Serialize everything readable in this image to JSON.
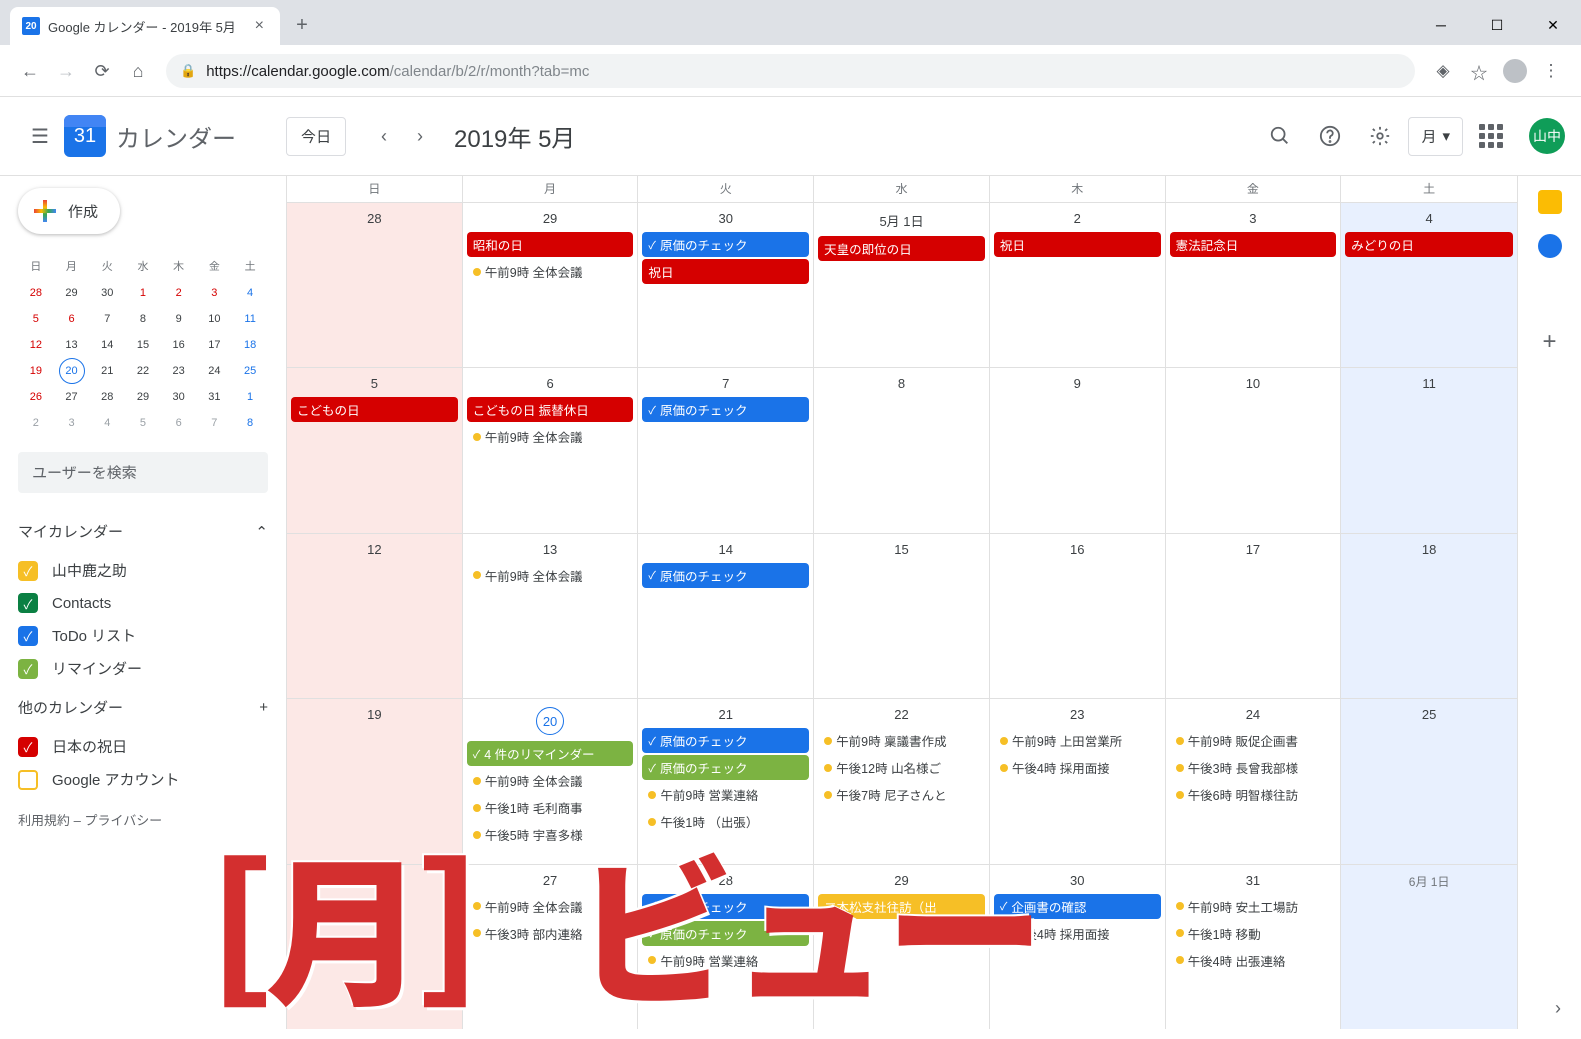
{
  "browser": {
    "tab_title": "Google カレンダー - 2019年 5月",
    "tab_favicon": "20",
    "url_host": "https://calendar.google.com",
    "url_path": "/calendar/b/2/r/month?tab=mc"
  },
  "header": {
    "app_title": "カレンダー",
    "logo_day": "31",
    "today_label": "今日",
    "month_title": "2019年 5月",
    "view_label": "月",
    "user_initials": "山中"
  },
  "sidebar": {
    "create_label": "作成",
    "search_placeholder": "ユーザーを検索",
    "my_calendars_label": "マイカレンダー",
    "other_calendars_label": "他のカレンダー",
    "calendars": [
      {
        "label": "山中鹿之助",
        "color": "#f6bf26",
        "checked": true
      },
      {
        "label": "Contacts",
        "color": "#0b8043",
        "checked": true
      },
      {
        "label": "ToDo リスト",
        "color": "#1a73e8",
        "checked": true
      },
      {
        "label": "リマインダー",
        "color": "#7cb342",
        "checked": true
      }
    ],
    "other_calendars": [
      {
        "label": "日本の祝日",
        "color": "#d50000",
        "checked": true
      },
      {
        "label": "Google アカウント",
        "color": "#f6bf26",
        "checked": false
      }
    ],
    "footer": "利用規約 – プライバシー",
    "mini_headers": [
      "日",
      "月",
      "火",
      "水",
      "木",
      "金",
      "土"
    ],
    "mini_rows": [
      [
        {
          "n": "28",
          "c": "red"
        },
        {
          "n": "29"
        },
        {
          "n": "30"
        },
        {
          "n": "1",
          "c": "red"
        },
        {
          "n": "2",
          "c": "red"
        },
        {
          "n": "3",
          "c": "red"
        },
        {
          "n": "4",
          "c": "blue"
        }
      ],
      [
        {
          "n": "5",
          "c": "red"
        },
        {
          "n": "6",
          "c": "red"
        },
        {
          "n": "7"
        },
        {
          "n": "8"
        },
        {
          "n": "9"
        },
        {
          "n": "10"
        },
        {
          "n": "11",
          "c": "blue"
        }
      ],
      [
        {
          "n": "12",
          "c": "red"
        },
        {
          "n": "13"
        },
        {
          "n": "14"
        },
        {
          "n": "15"
        },
        {
          "n": "16"
        },
        {
          "n": "17"
        },
        {
          "n": "18",
          "c": "blue"
        }
      ],
      [
        {
          "n": "19",
          "c": "red"
        },
        {
          "n": "20",
          "today": true
        },
        {
          "n": "21"
        },
        {
          "n": "22"
        },
        {
          "n": "23"
        },
        {
          "n": "24"
        },
        {
          "n": "25",
          "c": "blue"
        }
      ],
      [
        {
          "n": "26",
          "c": "red"
        },
        {
          "n": "27"
        },
        {
          "n": "28"
        },
        {
          "n": "29"
        },
        {
          "n": "30"
        },
        {
          "n": "31"
        },
        {
          "n": "1",
          "c": "blue"
        }
      ],
      [
        {
          "n": "2",
          "c": "other"
        },
        {
          "n": "3",
          "c": "other"
        },
        {
          "n": "4",
          "c": "other"
        },
        {
          "n": "5",
          "c": "other"
        },
        {
          "n": "6",
          "c": "other"
        },
        {
          "n": "7",
          "c": "other"
        },
        {
          "n": "8",
          "c": "blue"
        }
      ]
    ]
  },
  "grid": {
    "day_headers": [
      "日",
      "月",
      "火",
      "水",
      "木",
      "金",
      "土"
    ],
    "weeks": [
      [
        {
          "num": "28",
          "sun": true,
          "events": []
        },
        {
          "num": "29",
          "events": [
            {
              "t": "red",
              "label": "昭和の日"
            },
            {
              "t": "dot",
              "dc": "y",
              "label": "午前9時 全体会議"
            }
          ]
        },
        {
          "num": "30",
          "events": [
            {
              "t": "blue",
              "chk": true,
              "label": "原価のチェック"
            },
            {
              "t": "red",
              "label": "祝日"
            }
          ]
        },
        {
          "num": "5月 1日",
          "events": [
            {
              "t": "red",
              "label": "天皇の即位の日"
            }
          ]
        },
        {
          "num": "2",
          "events": [
            {
              "t": "red",
              "label": "祝日"
            }
          ]
        },
        {
          "num": "3",
          "events": [
            {
              "t": "red",
              "label": "憲法記念日"
            }
          ]
        },
        {
          "num": "4",
          "sat": true,
          "events": [
            {
              "t": "red",
              "label": "みどりの日"
            }
          ]
        }
      ],
      [
        {
          "num": "5",
          "sun": true,
          "events": [
            {
              "t": "red",
              "label": "こどもの日"
            }
          ]
        },
        {
          "num": "6",
          "events": [
            {
              "t": "red",
              "label": "こどもの日 振替休日"
            },
            {
              "t": "dot",
              "dc": "y",
              "label": "午前9時 全体会議"
            }
          ]
        },
        {
          "num": "7",
          "events": [
            {
              "t": "blue",
              "chk": true,
              "label": "原価のチェック"
            }
          ]
        },
        {
          "num": "8",
          "events": []
        },
        {
          "num": "9",
          "events": []
        },
        {
          "num": "10",
          "events": []
        },
        {
          "num": "11",
          "sat": true,
          "events": []
        }
      ],
      [
        {
          "num": "12",
          "sun": true,
          "events": []
        },
        {
          "num": "13",
          "events": [
            {
              "t": "dot",
              "dc": "y",
              "label": "午前9時 全体会議"
            }
          ]
        },
        {
          "num": "14",
          "events": [
            {
              "t": "blue",
              "chk": true,
              "label": "原価のチェック"
            }
          ]
        },
        {
          "num": "15",
          "events": []
        },
        {
          "num": "16",
          "events": []
        },
        {
          "num": "17",
          "events": []
        },
        {
          "num": "18",
          "sat": true,
          "events": []
        }
      ],
      [
        {
          "num": "19",
          "sun": true,
          "events": []
        },
        {
          "num": "20",
          "today": true,
          "events": [
            {
              "t": "green",
              "chk": true,
              "label": "4 件のリマインダー"
            },
            {
              "t": "dot",
              "dc": "y",
              "label": "午前9時 全体会議"
            },
            {
              "t": "dot",
              "dc": "y",
              "label": "午後1時 毛利商事"
            },
            {
              "t": "dot",
              "dc": "y",
              "label": "午後5時 宇喜多様"
            }
          ]
        },
        {
          "num": "21",
          "events": [
            {
              "t": "blue",
              "chk": true,
              "label": "原価のチェック"
            },
            {
              "t": "green",
              "chk": true,
              "label": "原価のチェック"
            },
            {
              "t": "dot",
              "dc": "y",
              "label": "午前9時 営業連絡"
            },
            {
              "t": "dot",
              "dc": "y",
              "label": "午後1時 （出張）"
            }
          ]
        },
        {
          "num": "22",
          "events": [
            {
              "t": "dot",
              "dc": "y",
              "label": "午前9時 稟議書作成"
            },
            {
              "t": "dot",
              "dc": "y",
              "label": "午後12時 山名様ご"
            },
            {
              "t": "dot",
              "dc": "y",
              "label": "午後7時 尼子さんと"
            }
          ]
        },
        {
          "num": "23",
          "events": [
            {
              "t": "dot",
              "dc": "y",
              "label": "午前9時 上田営業所"
            },
            {
              "t": "dot",
              "dc": "y",
              "label": "午後4時 採用面接"
            }
          ]
        },
        {
          "num": "24",
          "events": [
            {
              "t": "dot",
              "dc": "y",
              "label": "午前9時 販促企画書"
            },
            {
              "t": "dot",
              "dc": "y",
              "label": "午後3時 長曾我部様"
            },
            {
              "t": "dot",
              "dc": "y",
              "label": "午後6時 明智様往訪"
            }
          ]
        },
        {
          "num": "25",
          "sat": true,
          "events": []
        }
      ],
      [
        {
          "num": "26",
          "sun": true,
          "events": []
        },
        {
          "num": "27",
          "events": [
            {
              "t": "dot",
              "dc": "y",
              "label": "午前9時 全体会議"
            },
            {
              "t": "dot",
              "dc": "y",
              "label": "午後3時 部内連絡"
            }
          ]
        },
        {
          "num": "28",
          "events": [
            {
              "t": "blue",
              "chk": true,
              "label": "原価のチェック"
            },
            {
              "t": "green",
              "chk": true,
              "label": "原価のチェック"
            },
            {
              "t": "dot",
              "dc": "y",
              "label": "午前9時 営業連絡"
            }
          ]
        },
        {
          "num": "29",
          "events": [
            {
              "t": "yellow",
              "label": "二本松支社往訪（出"
            }
          ]
        },
        {
          "num": "30",
          "events": [
            {
              "t": "blue",
              "chk": true,
              "label": "企画書の確認"
            },
            {
              "t": "dot",
              "dc": "y",
              "label": "午後4時 採用面接"
            }
          ]
        },
        {
          "num": "31",
          "events": [
            {
              "t": "dot",
              "dc": "y",
              "label": "午前9時 安土工場訪"
            },
            {
              "t": "dot",
              "dc": "y",
              "label": "午後1時 移動"
            },
            {
              "t": "dot",
              "dc": "y",
              "label": "午後4時 出張連絡"
            }
          ]
        },
        {
          "num": "6月 1日",
          "sat": true,
          "small": true,
          "events": []
        }
      ]
    ]
  },
  "overlay": "［月］ビュー"
}
